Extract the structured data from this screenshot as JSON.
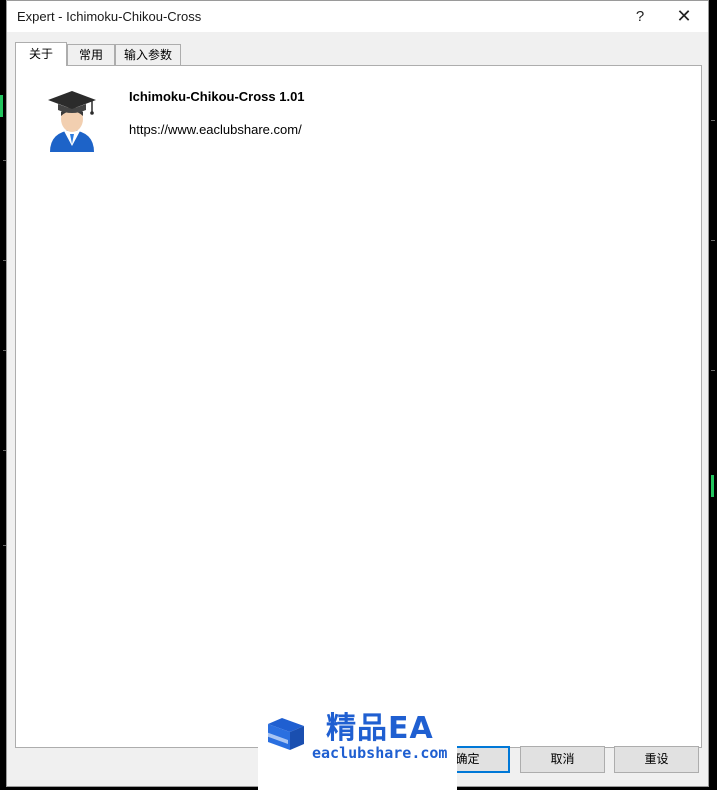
{
  "window": {
    "title": "Expert - Ichimoku-Chikou-Cross",
    "help_glyph": "?",
    "close_glyph": "✕"
  },
  "tabs": [
    {
      "label": "关于",
      "active": true
    },
    {
      "label": "常用",
      "active": false
    },
    {
      "label": "输入参数",
      "active": false
    }
  ],
  "about": {
    "icon": "graduate-user-icon",
    "name": "Ichimoku-Chikou-Cross 1.01",
    "url": "https://www.eaclubshare.com/"
  },
  "buttons": {
    "ok": "确定",
    "cancel": "取消",
    "reset": "重设"
  },
  "watermark": {
    "cn": "精品EA",
    "en": "eaclubshare.com",
    "color": "#1f5fd1"
  },
  "colors": {
    "focus_border": "#0078d7",
    "candle_up": "#22c55e"
  }
}
